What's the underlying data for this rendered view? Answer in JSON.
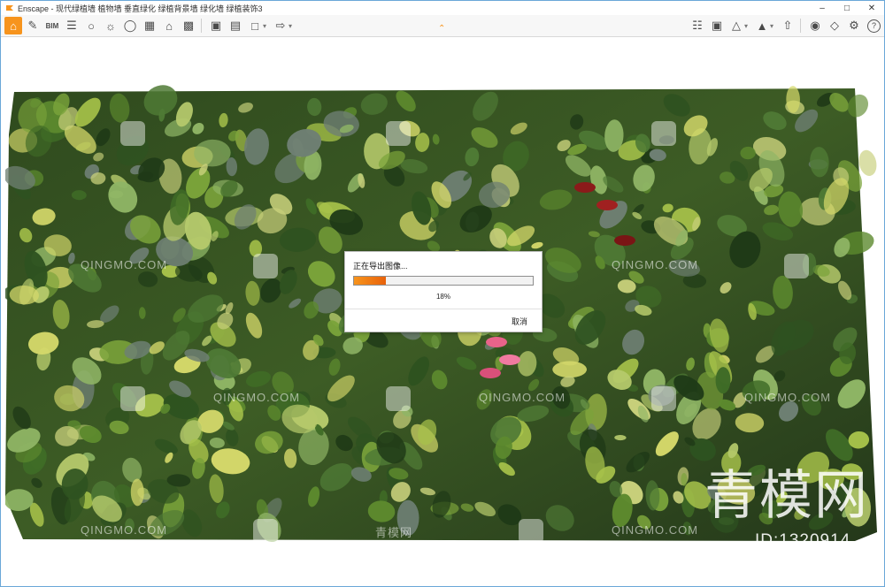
{
  "window": {
    "title": "Enscape - 现代绿植墙 植物墙 垂直绿化 绿植背景墙 绿化墙 绿植装饰3",
    "controls": [
      "minimize",
      "maximize",
      "close"
    ]
  },
  "toolbar": {
    "left_icons": [
      "home-icon",
      "tape-measure-icon",
      "bim-icon",
      "settings-list-icon",
      "gamepad-icon",
      "sun-icon",
      "lightbulb-icon",
      "building-icon",
      "house-icon",
      "clapperboard-icon",
      "screenshot-icon",
      "batch-render-icon",
      "panorama-icon",
      "export-icon"
    ],
    "right_icons": [
      "asset-library-icon",
      "material-editor-icon",
      "objects-icon",
      "views-icon",
      "upload-icon",
      "vr-headset-icon",
      "visual-settings-icon",
      "gear-icon",
      "help-icon"
    ],
    "accent": "#f7941d"
  },
  "viewport": {
    "watermarks": [
      "QINGMO.COM",
      "QINGMO.COM",
      "QINGMO.COM",
      "QINGMO.COM",
      "QINGMO.COM",
      "青模网",
      "QINGMO.COM",
      "QINGMO.COM"
    ],
    "brand_text": "青模网",
    "id_text": "ID:1320914"
  },
  "dialog": {
    "title": "正在导出图像...",
    "progress_fraction": 0.18,
    "progress_label": "18%",
    "cancel_label": "取消",
    "progress_color": "#f7941d"
  }
}
